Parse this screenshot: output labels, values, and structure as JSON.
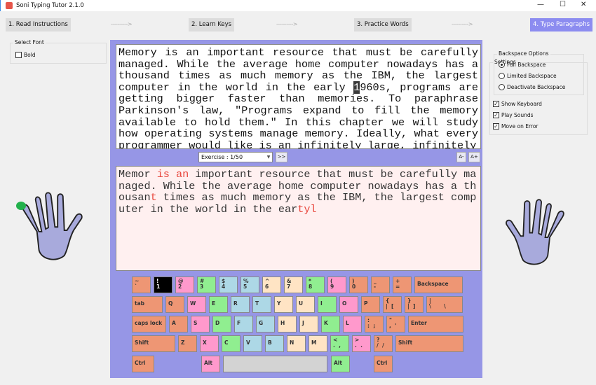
{
  "window": {
    "title": "Soni Typing Tutor 2.1.0",
    "minimize": "—",
    "maximize": "☐",
    "close": "✕"
  },
  "steps": [
    {
      "label": "1. Read Instructions"
    },
    {
      "label": "2. Learn Keys"
    },
    {
      "label": "3. Practice Words"
    },
    {
      "label": "4. Type Paragraphs",
      "active": true
    }
  ],
  "arrow": "---------->",
  "font_group": {
    "label": "Select Font",
    "bold_label": "Bold",
    "bold": false
  },
  "settings": {
    "label": "Settings",
    "backspace_label": "Backspace Options",
    "backspace_options": [
      {
        "label": "Full Backspace",
        "selected": true
      },
      {
        "label": "Limited Backspace",
        "selected": false
      },
      {
        "label": "Deactivate Backspace",
        "selected": false
      }
    ],
    "checks": [
      {
        "label": "Show Keyboard",
        "checked": true
      },
      {
        "label": "Play Sounds",
        "checked": true
      },
      {
        "label": "Move on Error",
        "checked": true
      }
    ],
    "check_mark": "✓"
  },
  "source": {
    "before": "Memory is an important resource that must be carefully managed. While the average home computer nowadays has a thousand times as much memory as the IBM, the largest computer in the world in the early ",
    "cursor": "1",
    "after": "960s, programs are getting bigger faster than memories. To paraphrase Parkinson's law, \"Programs expand to fill the memory available to hold them.\" In this chapter we will study how operating systems manage memory. Ideally, what every programmer would like is an infinitely large, infinitely"
  },
  "exercise": {
    "value": "Exercise : 1/50",
    "next": ">>",
    "font_smaller": "A-",
    "font_larger": "A+"
  },
  "typed": [
    {
      "t": "Memor "
    },
    {
      "t": "is an",
      "e": true
    },
    {
      "t": "  important resource that must be carefully managed. While the average home computer nowadays has a thousan"
    },
    {
      "t": "t",
      "e": true
    },
    {
      "t": " times as much memory as the IBM, the largest computer in the world in the ear"
    },
    {
      "t": "tyl",
      "e": true
    }
  ],
  "colors": {
    "orange": "#ee9674",
    "pink": "#ff99cc",
    "green": "#90ee90",
    "blue": "#add8e6",
    "peach": "#ffe4c4",
    "gray": "#d3d3d3",
    "active": "#000000",
    "panel": "#9696e6",
    "hand": "#a8aadc",
    "finger_marker": "#22b14c"
  },
  "keyboard": [
    [
      {
        "l": "~\n`",
        "c": "orange"
      },
      {
        "l": "!\n1",
        "c": "active"
      },
      {
        "l": "@\n2",
        "c": "pink"
      },
      {
        "l": "#\n3",
        "c": "green"
      },
      {
        "l": "$\n4",
        "c": "blue"
      },
      {
        "l": "%\n5",
        "c": "blue"
      },
      {
        "l": "^\n6",
        "c": "peach"
      },
      {
        "l": "&\n7",
        "c": "peach"
      },
      {
        "l": "*\n8",
        "c": "green"
      },
      {
        "l": "(\n9",
        "c": "pink"
      },
      {
        "l": ")\n0",
        "c": "orange"
      },
      {
        "l": "_\n-",
        "c": "orange"
      },
      {
        "l": "+\n=",
        "c": "orange"
      },
      {
        "l": "Backspace",
        "c": "orange"
      }
    ],
    [
      {
        "l": "tab",
        "c": "orange"
      },
      {
        "l": "Q",
        "c": "orange"
      },
      {
        "l": "W",
        "c": "pink"
      },
      {
        "l": "E",
        "c": "green"
      },
      {
        "l": "R",
        "c": "blue"
      },
      {
        "l": "T",
        "c": "blue"
      },
      {
        "l": "Y",
        "c": "peach"
      },
      {
        "l": "U",
        "c": "peach"
      },
      {
        "l": "I",
        "c": "green"
      },
      {
        "l": "O",
        "c": "pink"
      },
      {
        "l": "P",
        "c": "orange"
      },
      {
        "l": "{\n|  [",
        "c": "orange"
      },
      {
        "l": "}\n|  ]",
        "c": "orange"
      },
      {
        "l": "|\n\\       \\",
        "c": "orange"
      }
    ],
    [
      {
        "l": "caps lock",
        "c": "orange"
      },
      {
        "l": "A",
        "c": "orange"
      },
      {
        "l": "S",
        "c": "pink"
      },
      {
        "l": "D",
        "c": "green"
      },
      {
        "l": "F",
        "c": "blue"
      },
      {
        "l": "G",
        "c": "blue"
      },
      {
        "l": "H",
        "c": "peach"
      },
      {
        "l": "J",
        "c": "peach"
      },
      {
        "l": "K",
        "c": "green"
      },
      {
        "l": "L",
        "c": "pink"
      },
      {
        "l": ":\n:  ;",
        "c": "orange"
      },
      {
        "l": "\"\n,  '",
        "c": "orange"
      },
      {
        "l": "Enter",
        "c": "orange"
      }
    ],
    [
      {
        "l": "Shift",
        "c": "orange"
      },
      {
        "l": "Z",
        "c": "orange"
      },
      {
        "l": "X",
        "c": "pink"
      },
      {
        "l": "C",
        "c": "green"
      },
      {
        "l": "V",
        "c": "blue"
      },
      {
        "l": "B",
        "c": "blue"
      },
      {
        "l": "N",
        "c": "peach"
      },
      {
        "l": "M",
        "c": "peach"
      },
      {
        "l": "<\n.  ,",
        "c": "green"
      },
      {
        "l": ">\n.  .",
        "c": "pink"
      },
      {
        "l": "?\n/  /",
        "c": "orange"
      },
      {
        "l": "Shift",
        "c": "orange"
      }
    ],
    [
      {
        "l": "Ctrl",
        "c": "orange"
      },
      {
        "l": "Alt",
        "c": "pink"
      },
      {
        "l": "",
        "c": "gray"
      },
      {
        "l": "Alt",
        "c": "green"
      },
      {
        "l": "Ctrl",
        "c": "orange"
      }
    ]
  ]
}
